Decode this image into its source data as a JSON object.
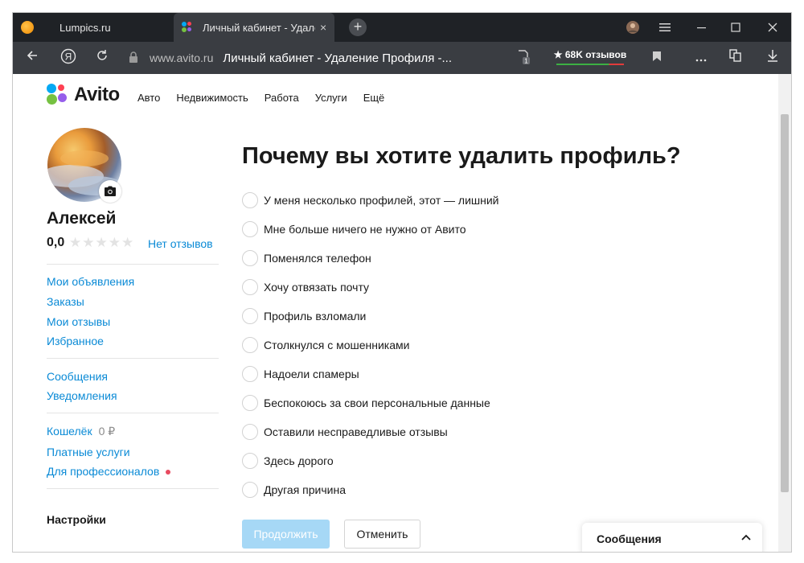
{
  "browser": {
    "tabs": [
      {
        "title": "Lumpics.ru",
        "active": false
      },
      {
        "title": "Личный кабинет - Удаление Профиля",
        "active": true
      }
    ],
    "tab_close_icon": "×",
    "new_tab_icon": "+",
    "address": {
      "domain": "www.avito.ru",
      "page_title": "Личный кабинет - Удаление Профиля -..."
    },
    "reviews_pill": "★ 68K отзывов",
    "ad_block_count": "1",
    "icons": [
      "back-icon",
      "yandex-icon",
      "reload-icon",
      "lock-icon",
      "extension-icon",
      "bookmark-icon",
      "more-icon",
      "collections-icon",
      "download-icon",
      "profile-icon",
      "menu-icon",
      "minimize-icon",
      "maximize-icon",
      "close-icon"
    ]
  },
  "header": {
    "logo": "Avito",
    "nav": [
      "Авто",
      "Недвижимость",
      "Работа",
      "Услуги",
      "Ещё"
    ]
  },
  "sidebar": {
    "user_name": "Алексей",
    "rating": "0,0",
    "stars": "★★★★★",
    "rating_value": 0,
    "no_reviews": "Нет отзывов",
    "group1": [
      "Мои объявления",
      "Заказы",
      "Мои отзывы",
      "Избранное"
    ],
    "group2": [
      "Сообщения",
      "Уведомления"
    ],
    "wallet_label": "Кошелёк",
    "wallet_amount": "0 ₽",
    "paid_services": "Платные услуги",
    "for_pros": "Для профессионалов",
    "settings": "Настройки"
  },
  "main": {
    "title": "Почему вы хотите удалить профиль?",
    "options": [
      "У меня несколько профилей, этот — лишний",
      "Мне больше ничего не нужно от Авито",
      "Поменялся телефон",
      "Хочу отвязать почту",
      "Профиль взломали",
      "Столкнулся с мошенниками",
      "Надоели спамеры",
      "Беспокоюсь за свои персональные данные",
      "Оставили несправедливые отзывы",
      "Здесь дорого",
      "Другая причина"
    ],
    "continue_button": "Продолжить",
    "cancel_button": "Отменить"
  },
  "messages_widget": {
    "title": "Сообщения"
  },
  "colors": {
    "link": "#0a8ad6",
    "continue_disabled": "#a6d8f6",
    "tabbar": "#1f2226",
    "toolbar": "#3a3d42",
    "logo_blue": "#04a9f4",
    "logo_green": "#76c142",
    "logo_purple": "#965eeb",
    "logo_red": "#ff4053"
  }
}
